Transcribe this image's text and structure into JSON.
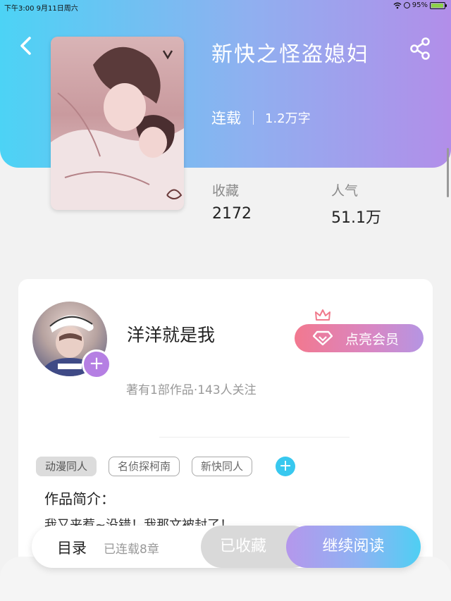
{
  "status_bar": {
    "time": "下午3:00  9月11日周六",
    "battery": "95%",
    "battery_level": 0.95
  },
  "book": {
    "title": "新快之怪盗媳妇",
    "status": "连载",
    "word_count": "1.2万字",
    "favorites_label": "收藏",
    "favorites": "2172",
    "popularity_label": "人气",
    "popularity": "51.1万"
  },
  "author": {
    "name": "洋洋就是我",
    "meta": "著有1部作品·143人关注",
    "follow_symbol": "+",
    "vip_label": "点亮会员"
  },
  "tags": [
    "动漫同人",
    "名侦探柯南",
    "新快同人"
  ],
  "tag_add_symbol": "+",
  "intro": {
    "title": "作品简介：",
    "text": "我又来惹~没错！我那文被封了！"
  },
  "bottom_bar": {
    "catalog_label": "目录",
    "chapters_label": "已连载8章",
    "favorited_label": "已收藏",
    "continue_label": "继续阅读"
  },
  "colors": {
    "header_start": "#4cd3f5",
    "header_end": "#b28ee9",
    "vip_start": "#f2788f",
    "accent_blue": "#38c8ef",
    "accent_purple": "#b57fe3"
  }
}
